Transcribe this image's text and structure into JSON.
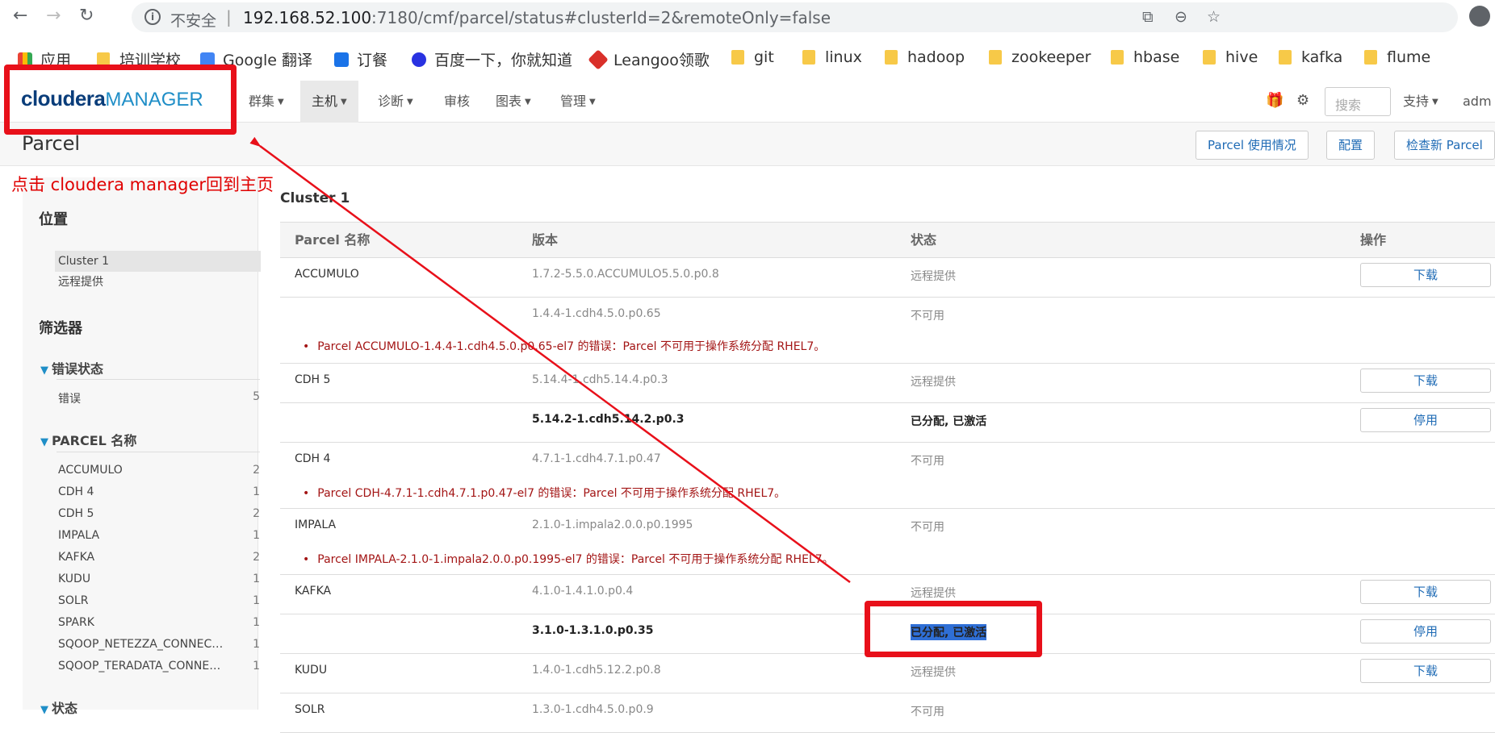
{
  "browser": {
    "not_secure": "不安全",
    "separator": "|",
    "url_host": "192.168.52.100",
    "url_rest": ":7180/cmf/parcel/status#clusterId=2&remoteOnly=false"
  },
  "bookmarks": [
    {
      "label": "应用",
      "icon": "apps-grid-icon"
    },
    {
      "label": "培训学校",
      "icon": "folder-icon"
    },
    {
      "label": "Google 翻译",
      "icon": "google-translate-icon"
    },
    {
      "label": "订餐",
      "icon": "k-app-icon"
    },
    {
      "label": "百度一下，你就知道",
      "icon": "baidu-paw-icon"
    },
    {
      "label": "Leangoo领歌",
      "icon": "leangoo-icon"
    },
    {
      "label": "git",
      "icon": "folder-icon"
    },
    {
      "label": "linux",
      "icon": "folder-icon"
    },
    {
      "label": "hadoop",
      "icon": "folder-icon"
    },
    {
      "label": "zookeeper",
      "icon": "folder-icon"
    },
    {
      "label": "hbase",
      "icon": "folder-icon"
    },
    {
      "label": "hive",
      "icon": "folder-icon"
    },
    {
      "label": "kafka",
      "icon": "folder-icon"
    },
    {
      "label": "flume",
      "icon": "folder-icon"
    }
  ],
  "header": {
    "logo_bold": "cloudera",
    "logo_light": "MANAGER",
    "menus": [
      "群集",
      "主机",
      "诊断",
      "审核",
      "图表",
      "管理"
    ],
    "search_placeholder": "搜索",
    "support": "支持",
    "user": "adm"
  },
  "page": {
    "title": "Parcel",
    "buttons": [
      "Parcel 使用情况",
      "配置",
      "检查新 Parcel"
    ]
  },
  "annotation": {
    "text": "点击 cloudera manager回到主页",
    "color": "#e8101a"
  },
  "sidebar": {
    "location_heading": "位置",
    "locations": [
      "Cluster 1",
      "远程提供"
    ],
    "filter_heading": "筛选器",
    "error_section": "错误状态",
    "errors": [
      {
        "name": "错误",
        "count": "5"
      }
    ],
    "parcel_section": "PARCEL 名称",
    "parcels": [
      {
        "name": "ACCUMULO",
        "count": "2"
      },
      {
        "name": "CDH 4",
        "count": "1"
      },
      {
        "name": "CDH 5",
        "count": "2"
      },
      {
        "name": "IMPALA",
        "count": "1"
      },
      {
        "name": "KAFKA",
        "count": "2"
      },
      {
        "name": "KUDU",
        "count": "1"
      },
      {
        "name": "SOLR",
        "count": "1"
      },
      {
        "name": "SPARK",
        "count": "1"
      },
      {
        "name": "SQOOP_NETEZZA_CONNECTOR",
        "count": "1"
      },
      {
        "name": "SQOOP_TERADATA_CONNECTOR",
        "count": "1"
      }
    ],
    "status_section": "状态"
  },
  "cluster": {
    "title": "Cluster 1",
    "columns": [
      "Parcel 名称",
      "版本",
      "状态",
      "操作"
    ],
    "rows": [
      {
        "name": "ACCUMULO",
        "version": "1.7.2-5.5.0.ACCUMULO5.5.0.p0.8",
        "status": "远程提供",
        "action": "下载"
      },
      {
        "name": "",
        "version": "1.4.4-1.cdh4.5.0.p0.65",
        "status": "不可用",
        "action": "",
        "error": "Parcel ACCUMULO-1.4.4-1.cdh4.5.0.p0.65-el7 的错误：Parcel 不可用于操作系统分配 RHEL7。"
      },
      {
        "name": "CDH 5",
        "version": "5.14.4-1.cdh5.14.4.p0.3",
        "status": "远程提供",
        "action": "下载"
      },
      {
        "name": "",
        "version": "5.14.2-1.cdh5.14.2.p0.3",
        "status": "已分配, 已激活",
        "action": "停用"
      },
      {
        "name": "CDH 4",
        "version": "4.7.1-1.cdh4.7.1.p0.47",
        "status": "不可用",
        "action": "",
        "error": "Parcel CDH-4.7.1-1.cdh4.7.1.p0.47-el7 的错误：Parcel 不可用于操作系统分配 RHEL7。"
      },
      {
        "name": "IMPALA",
        "version": "2.1.0-1.impala2.0.0.p0.1995",
        "status": "不可用",
        "action": "",
        "error": "Parcel IMPALA-2.1.0-1.impala2.0.0.p0.1995-el7 的错误：Parcel 不可用于操作系统分配 RHEL7。"
      },
      {
        "name": "KAFKA",
        "version": "4.1.0-1.4.1.0.p0.4",
        "status": "远程提供",
        "action": "下载"
      },
      {
        "name": "",
        "version": "3.1.0-1.3.1.0.p0.35",
        "status": "已分配, 已激活",
        "action": "停用"
      },
      {
        "name": "KUDU",
        "version": "1.4.0-1.cdh5.12.2.p0.8",
        "status": "远程提供",
        "action": "下载"
      },
      {
        "name": "SOLR",
        "version": "1.3.0-1.cdh4.5.0.p0.9",
        "status": "不可用",
        "action": ""
      }
    ]
  }
}
